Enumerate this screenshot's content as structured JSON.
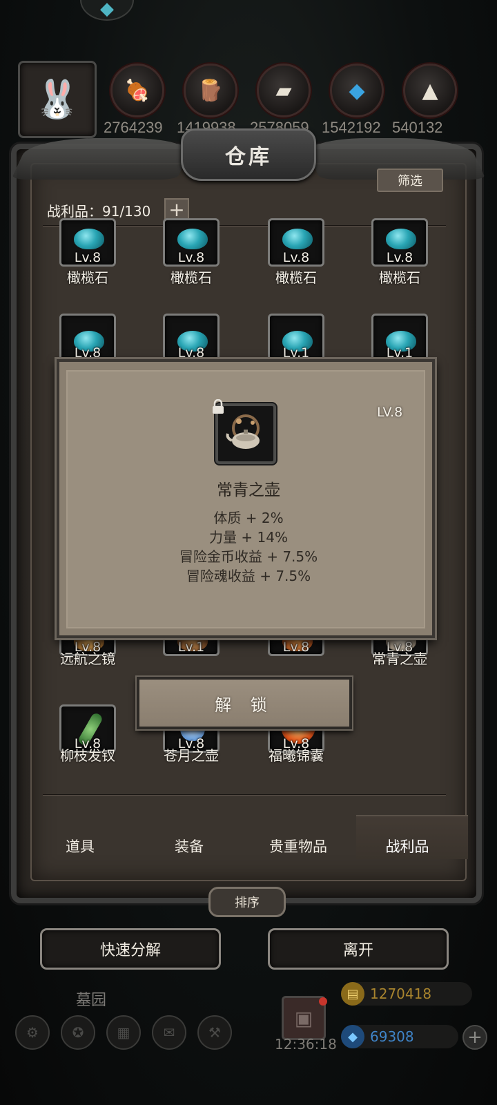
{
  "resources": {
    "values": [
      "2764239",
      "1419938",
      "2578059",
      "1542192",
      "540132"
    ]
  },
  "panel": {
    "title": "仓库",
    "filter_label": "筛选",
    "loot_label": "战利品：91/130",
    "plus_label": "+"
  },
  "grid": {
    "row1": [
      {
        "lv": "Lv.8",
        "name": "橄榄石"
      },
      {
        "lv": "Lv.8",
        "name": "橄榄石"
      },
      {
        "lv": "Lv.8",
        "name": "橄榄石"
      },
      {
        "lv": "Lv.8",
        "name": "橄榄石"
      }
    ],
    "row2": [
      {
        "lv": "Lv.8"
      },
      {
        "lv": "Lv.8"
      },
      {
        "lv": "Lv.1"
      },
      {
        "lv": "Lv.1"
      }
    ],
    "row4": [
      {
        "lv": "Lv.8",
        "name": "远航之镜"
      },
      {
        "lv": "Lv.1"
      },
      {
        "lv": "Lv.8"
      },
      {
        "lv": "Lv.8",
        "name": "常青之壶"
      }
    ],
    "row5": [
      {
        "lv": "Lv.8",
        "name": "柳枝发钗"
      },
      {
        "lv": "Lv.8",
        "name": "苍月之壶"
      },
      {
        "lv": "Lv.8",
        "name": "福曦锦囊"
      }
    ]
  },
  "popup": {
    "level": "LV.8",
    "item_name": "常青之壶",
    "stats": [
      "体质 + 2%",
      "力量 + 14%",
      "冒险金币收益 + 7.5%",
      "冒险魂收益 + 7.5%"
    ],
    "unlock_label": "解 锁"
  },
  "tabs": [
    "道具",
    "装备",
    "贵重物品",
    "战利品"
  ],
  "sort_label": "排序",
  "actions": {
    "quick_decompose": "快速分解",
    "leave": "离开"
  },
  "bottom": {
    "location": "墓园",
    "clock": "12:36:18",
    "gold": "1270418",
    "gems": "69308"
  },
  "colors": {
    "gold_text": "#a8842e",
    "gem_text": "#3f84c8"
  }
}
